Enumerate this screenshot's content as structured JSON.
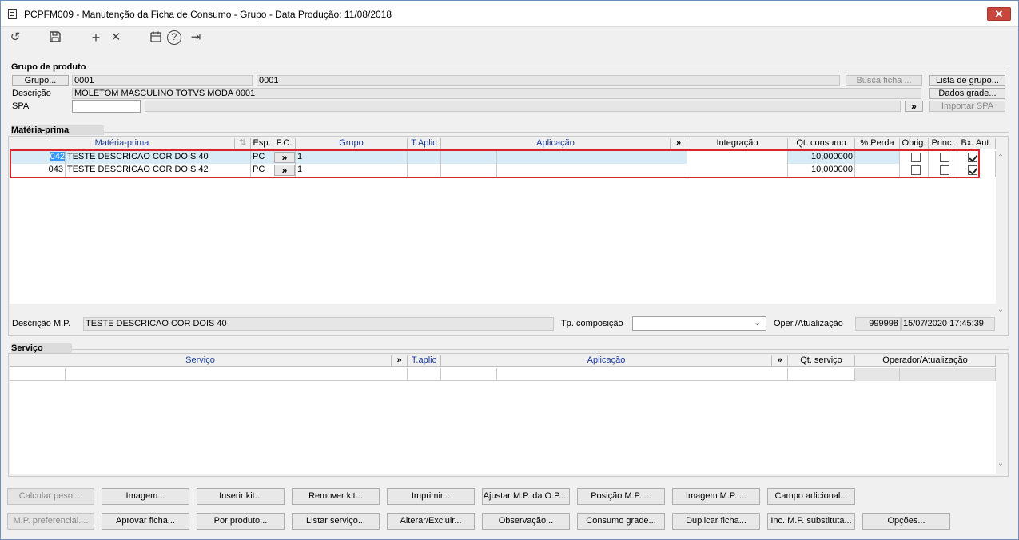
{
  "window": {
    "title": "PCPFM009 - Manutenção da Ficha de Consumo - Grupo - Data Produção: 11/08/2018",
    "close_glyph": "✕"
  },
  "toolbar": {
    "icons": [
      "undo-icon",
      "save-icon",
      "add-icon",
      "delete-icon",
      "calendar-icon",
      "help-icon",
      "exit-icon"
    ],
    "glyphs": {
      "undo": "↺",
      "add": "+",
      "delete": "✕",
      "help": "?",
      "exit": "⇥"
    }
  },
  "grupo": {
    "section_title": "Grupo de produto",
    "grupo_button": "Grupo...",
    "grupo_code": "0001",
    "grupo_name": "0001",
    "busca_ficha": "Busca ficha ...",
    "lista_grupo": "Lista de grupo...",
    "descricao_label": "Descrição",
    "descricao_value": "MOLETOM MASCULINO TOTVS MODA 0001",
    "dados_grade": "Dados grade...",
    "spa_label": "SPA",
    "spa_value": "",
    "spa_desc": "",
    "spa_arrow": "»",
    "importar_spa": "Importar SPA"
  },
  "materia": {
    "section_title": "Matéria-prima",
    "headers": {
      "materia": "Matéria-prima",
      "esp": "Esp.",
      "fc": "F.C.",
      "grupo": "Grupo",
      "taplic": "T.Aplic",
      "aplicacao": "Aplicação",
      "more": "»",
      "integracao": "Integração",
      "qt_consumo": "Qt. consumo",
      "perda": "% Perda",
      "obrig": "Obrig.",
      "princ": "Princ.",
      "bxaut": "Bx. Aut."
    },
    "rows": [
      {
        "code": "042",
        "desc": "TESTE DESCRICAO COR DOIS 40",
        "esp": "PC",
        "fc": "»",
        "grupo": "1",
        "qt": "10,000000",
        "obrig": false,
        "princ": false,
        "bxaut": true
      },
      {
        "code": "043",
        "desc": "TESTE DESCRICAO COR DOIS 42",
        "esp": "PC",
        "fc": "»",
        "grupo": "1",
        "qt": "10,000000",
        "obrig": false,
        "princ": false,
        "bxaut": true
      }
    ],
    "descricao_mp_label": "Descrição M.P.",
    "descricao_mp_value": "TESTE DESCRICAO COR DOIS 40",
    "tp_composicao_label": "Tp. composição",
    "tp_composicao_value": "",
    "oper_label": "Oper./Atualização",
    "oper_code": "999998",
    "oper_datetime": "15/07/2020 17:45:39"
  },
  "servico": {
    "section_title": "Serviço",
    "headers": {
      "servico": "Serviço",
      "more1": "»",
      "taplic": "T.aplic",
      "aplicacao": "Aplicação",
      "more2": "»",
      "qt_servico": "Qt. serviço",
      "operador": "Operador/Atualização"
    }
  },
  "buttons": {
    "row1": [
      "Calcular peso ...",
      "Imagem...",
      "Inserir kit...",
      "Remover kit...",
      "Imprimir...",
      "Ajustar M.P. da O.P....",
      "Posição M.P. ...",
      "Imagem M.P. ...",
      "Campo adicional..."
    ],
    "row2": [
      "M.P. preferencial....",
      "Aprovar ficha...",
      "Por produto...",
      "Listar serviço...",
      "Alterar/Excluir...",
      "Observação...",
      "Consumo grade...",
      "Duplicar ficha...",
      "Inc. M.P. substituta...",
      "Opções..."
    ]
  }
}
